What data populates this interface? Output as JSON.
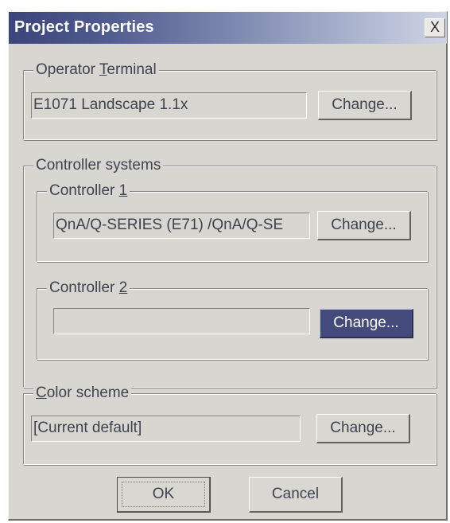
{
  "dialog": {
    "title": "Project Properties",
    "close_glyph": "X"
  },
  "operator_terminal": {
    "legend_pre": "Operator ",
    "legend_acc": "T",
    "legend_post": "erminal",
    "value": "E1071 Landscape 1.1x",
    "change_label": "Change..."
  },
  "controller_systems": {
    "legend": "Controller systems",
    "controller1": {
      "legend_pre": "Controller ",
      "legend_acc": "1",
      "value": "QnA/Q-SERIES (E71) /QnA/Q-SE",
      "change_label": "Change..."
    },
    "controller2": {
      "legend_pre": "Controller ",
      "legend_acc": "2",
      "value": "",
      "change_label": "Change..."
    }
  },
  "color_scheme": {
    "legend_acc": "C",
    "legend_post": "olor scheme",
    "value": "[Current default]",
    "change_label": "Change..."
  },
  "footer": {
    "ok_label": "OK",
    "cancel_label": "Cancel"
  },
  "colors": {
    "dialog_bg": "#d8d6d0",
    "title_start": "#3c457b",
    "focused_button": "#454a7d"
  }
}
